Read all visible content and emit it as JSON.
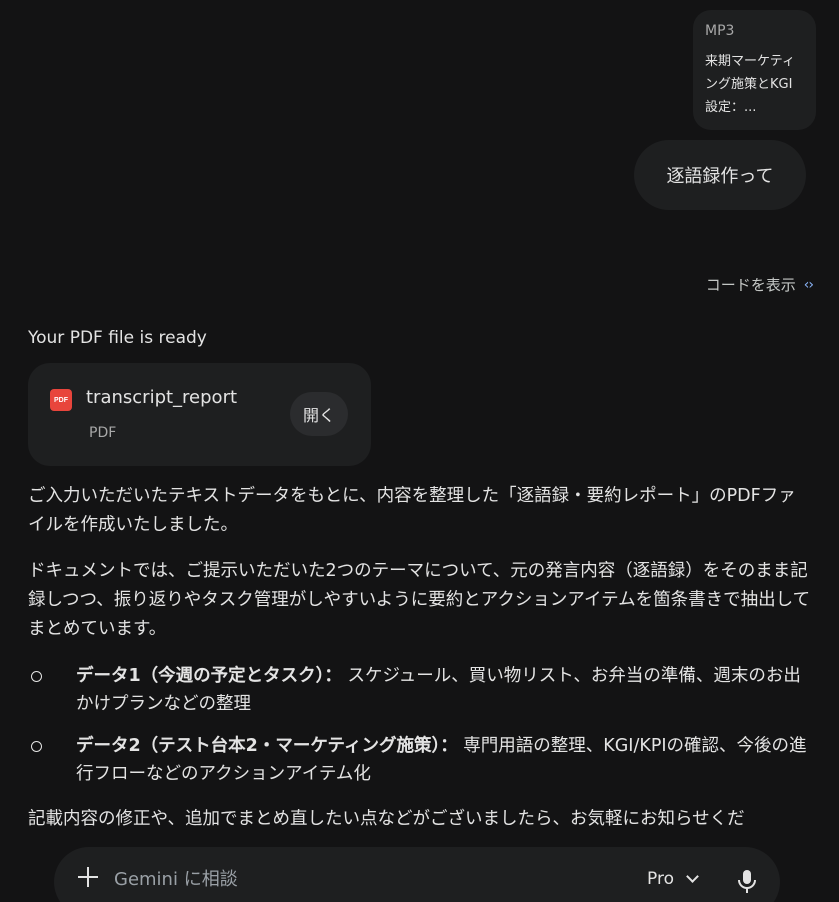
{
  "attachment": {
    "type": "MP3",
    "name": "来期マーケティング施策とKGI設定：..."
  },
  "user_message": "逐語録作って",
  "show_code_label": "コードを表示",
  "response": {
    "ready_title": "Your PDF file is ready",
    "pdf": {
      "name": "transcript_report",
      "type": "PDF",
      "badge": "PDF",
      "open_label": "開く"
    },
    "paragraph1": "ご入力いただいたテキストデータをもとに、内容を整理した「逐語録・要約レポート」のPDFファイルを作成いたしました。",
    "paragraph2": "ドキュメントでは、ご提示いただいた2つのテーマについて、元の発言内容（逐語録）をそのまま記録しつつ、振り返りやタスク管理がしやすいように要約とアクションアイテムを箇条書きで抽出してまとめています。",
    "bullets": [
      {
        "heading": "データ1（今週の予定とタスク）：",
        "body": " スケジュール、買い物リスト、お弁当の準備、週末のお出かけプランなどの整理"
      },
      {
        "heading": "データ2（テスト台本2・マーケティング施策）：",
        "body": " 専門用語の整理、KGI/KPIの確認、今後の進行フローなどのアクションアイテム化"
      }
    ],
    "paragraph3": "記載内容の修正や、追加でまとめ直したい点などがございましたら、お気軽にお知らせくだ"
  },
  "input_bar": {
    "placeholder": "Gemini に相談",
    "model": "Pro"
  },
  "colors": {
    "background": "#131314",
    "surface": "#1e1f20",
    "accent": "#8ab4f8",
    "pdf_red": "#e8453c"
  },
  "icons": {
    "add": "plus-icon",
    "model_dropdown": "chevron-down-icon",
    "voice": "microphone-icon",
    "code": "code-icon",
    "file": "pdf-icon"
  }
}
